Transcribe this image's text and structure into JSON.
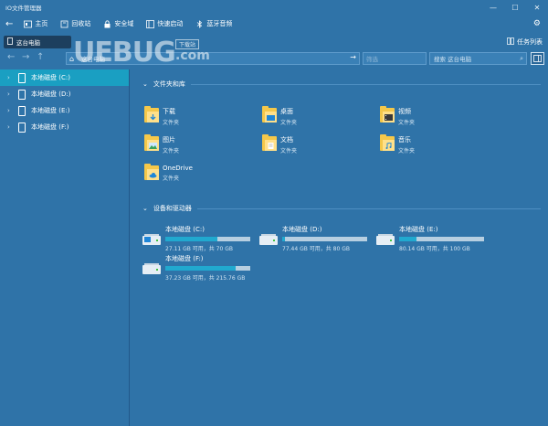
{
  "window": {
    "title": "IO文件管理器",
    "controls": [
      "—",
      "☐",
      "✕"
    ]
  },
  "toolbar": {
    "back_icon": "←",
    "items": [
      {
        "label": "主页",
        "icon": "home-icon"
      },
      {
        "label": "回收站",
        "icon": "recycle-bin-icon"
      },
      {
        "label": "安全域",
        "icon": "lock-icon"
      },
      {
        "label": "快速启动",
        "icon": "launch-icon"
      },
      {
        "label": "蓝牙音频",
        "icon": "bluetooth-icon"
      }
    ],
    "settings_icon": "⚙"
  },
  "tabs": [
    {
      "label": "这台电脑"
    }
  ],
  "task_view": {
    "label": "任务列表"
  },
  "address": {
    "crumb": "这台电脑",
    "filter_placeholder": "筛选",
    "search_placeholder": "搜索 这台电脑"
  },
  "watermark": {
    "brand": "UEBUG",
    "domain": ".com",
    "tag": "下载站"
  },
  "sidebar": {
    "items": [
      {
        "label": "本地磁盘 (C:)",
        "selected": true
      },
      {
        "label": "本地磁盘 (D:)",
        "selected": false
      },
      {
        "label": "本地磁盘 (E:)",
        "selected": false
      },
      {
        "label": "本地磁盘 (F:)",
        "selected": false
      }
    ]
  },
  "sections": {
    "libraries": "文件夹和库",
    "devices": "设备和驱动器"
  },
  "folders": [
    {
      "name": "下载",
      "sub": "文件夹",
      "badge": "download"
    },
    {
      "name": "桌面",
      "sub": "文件夹",
      "badge": "desktop"
    },
    {
      "name": "视频",
      "sub": "文件夹",
      "badge": "video"
    },
    {
      "name": "图片",
      "sub": "文件夹",
      "badge": "picture"
    },
    {
      "name": "文档",
      "sub": "文件夹",
      "badge": "document"
    },
    {
      "name": "音乐",
      "sub": "文件夹",
      "badge": "music"
    },
    {
      "name": "OneDrive",
      "sub": "文件夹",
      "badge": "cloud"
    }
  ],
  "drives": [
    {
      "name": "本地磁盘 (C:)",
      "info": "27.11 GB 可用，共 70 GB",
      "used_fraction": 0.61,
      "system": true
    },
    {
      "name": "本地磁盘 (D:)",
      "info": "77.44 GB 可用，共 80 GB",
      "used_fraction": 0.03,
      "system": false
    },
    {
      "name": "本地磁盘 (E:)",
      "info": "80.14 GB 可用，共 100 GB",
      "used_fraction": 0.2,
      "system": false
    },
    {
      "name": "本地磁盘 (F:)",
      "info": "37.23 GB 可用，共 215.76 GB",
      "used_fraction": 0.83,
      "system": false
    }
  ],
  "colors": {
    "background": "#2f73a8",
    "selected": "#1a9fc2",
    "bar_fill": "#21a9cf",
    "bar_track": "#b7cfe1"
  }
}
